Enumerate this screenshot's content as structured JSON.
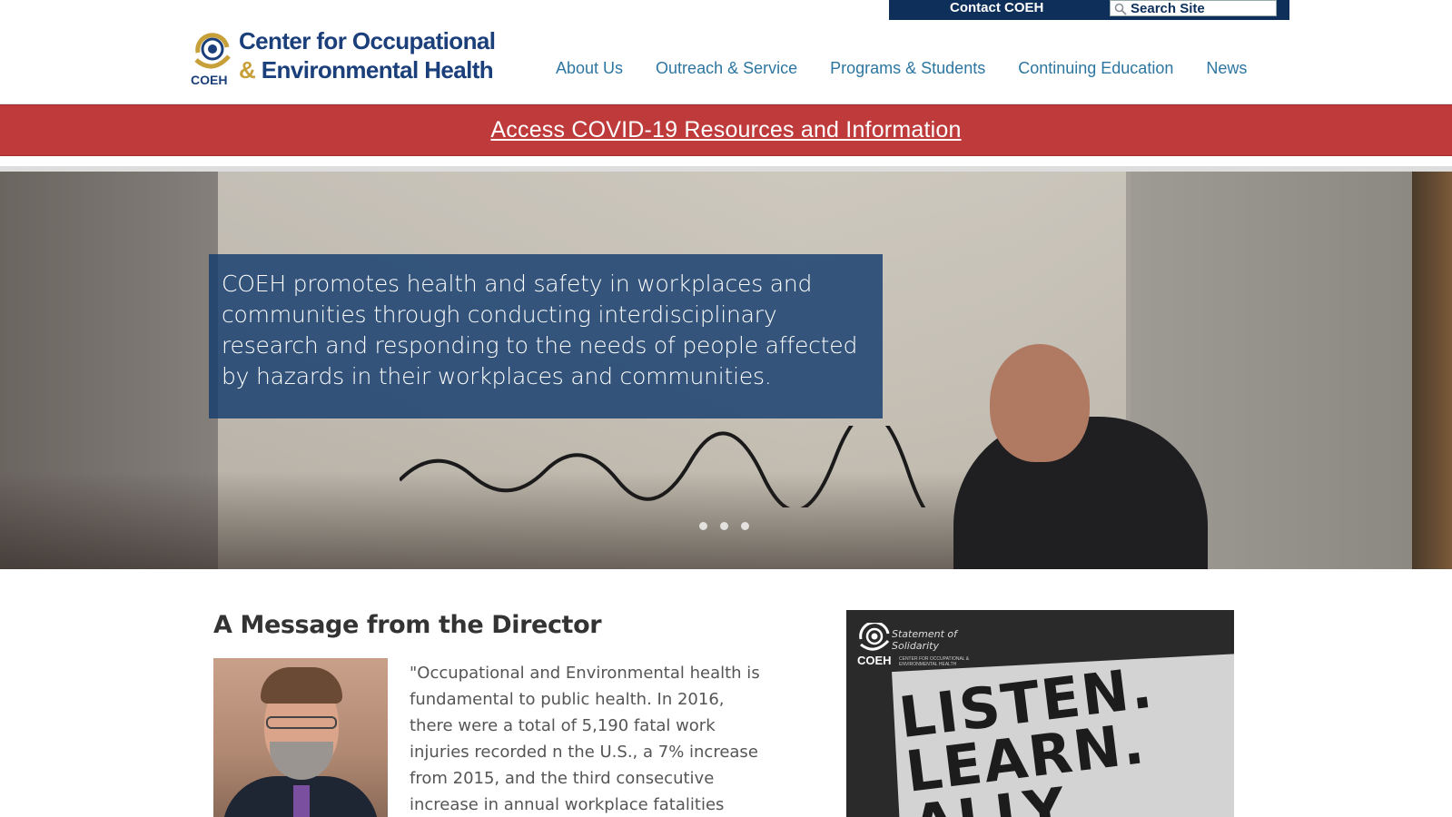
{
  "utility_bar": {
    "contact_label": "Contact COEH",
    "search_placeholder": "Search Site"
  },
  "header": {
    "logo": {
      "mark_text": "COEH",
      "line1": "Center for Occupational",
      "line2_amp": "&",
      "line2_rest": " Environmental Health"
    },
    "nav": [
      {
        "label": "About Us"
      },
      {
        "label": "Outreach & Service"
      },
      {
        "label": "Programs & Students"
      },
      {
        "label": "Continuing Education"
      },
      {
        "label": "News"
      }
    ]
  },
  "banner": {
    "link_text": " Access COVID-19 Resources and Information",
    "color": "#bf3b3b"
  },
  "hero": {
    "caption": "COEH promotes health and safety in workplaces and communities through conducting interdisciplinary research and responding to the needs of people affected by hazards in their workplaces and communities.",
    "slides_count": 3
  },
  "director": {
    "title": "A Message from the Director",
    "quote": "\"Occupational and Environmental health is fundamental to public health. In 2016, there were a total of 5,190 fatal work injuries recorded n the U.S., a 7% increase from 2015, and the third consecutive increase in annual workplace fatalities"
  },
  "solidarity": {
    "statement_line1": "Statement of",
    "statement_line2": "Solidarity",
    "coeh": "COEH",
    "subtitle": "CENTER FOR OCCUPATIONAL & ENVIRONMENTAL HEALTH",
    "sign_line1": "LISTEN.",
    "sign_line2": "LEARN.",
    "sign_line3": "ALLY"
  },
  "colors": {
    "brand_navy": "#1b3f7a",
    "brand_gold": "#c8a03a",
    "nav_link": "#2d76a0",
    "utility_bar": "#0d2f5a"
  }
}
